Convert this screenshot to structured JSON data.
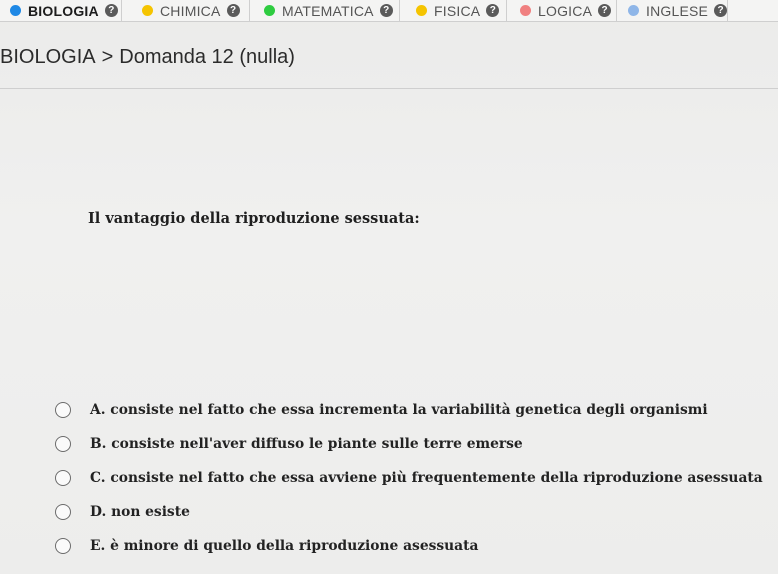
{
  "tabs": [
    {
      "label": "BIOLOGIA",
      "color": "#1e88e5",
      "active": true
    },
    {
      "label": "CHIMICA",
      "color": "#f5c400",
      "active": false
    },
    {
      "label": "MATEMATICA",
      "color": "#2ecc40",
      "active": false
    },
    {
      "label": "FISICA",
      "color": "#f5c400",
      "active": false
    },
    {
      "label": "LOGICA",
      "color": "#f08080",
      "active": false
    },
    {
      "label": "INGLESE",
      "color": "#8fb6e8",
      "active": false
    }
  ],
  "help_glyph": "?",
  "breadcrumb": {
    "subject": "BIOLOGIA",
    "separator": ">",
    "item": "Domanda 12 (nulla)"
  },
  "question": {
    "text": "Il vantaggio della riproduzione sessuata:"
  },
  "options": [
    {
      "text": "A. consiste nel fatto che essa incrementa la variabilità genetica degli organismi"
    },
    {
      "text": "B. consiste nell'aver diffuso le piante sulle terre emerse"
    },
    {
      "text": "C. consiste nel fatto che essa avviene più frequentemente della riproduzione asessuata"
    },
    {
      "text": "D. non esiste"
    },
    {
      "text": "E. è minore di quello della riproduzione asessuata"
    }
  ]
}
